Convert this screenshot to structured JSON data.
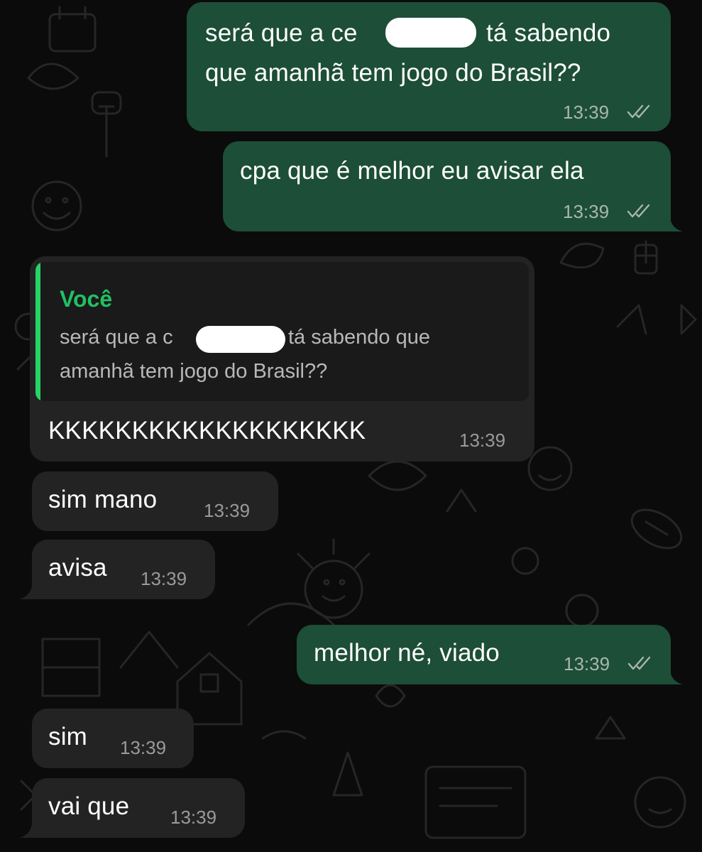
{
  "colors": {
    "outgoing_bubble": "#1d4e37",
    "incoming_bubble": "#232323",
    "quote_accent": "#21c063",
    "background": "#0b0b0b"
  },
  "messages": [
    {
      "id": "m1",
      "direction": "outgoing",
      "lines": [
        "será que a ce",
        "tá sabendo",
        "que amanhã tem jogo do Brasil??"
      ],
      "time": "13:39",
      "status": "read"
    },
    {
      "id": "m2",
      "direction": "outgoing",
      "text": "cpa que é melhor eu avisar ela",
      "time": "13:39",
      "status": "read"
    },
    {
      "id": "m3",
      "direction": "incoming",
      "reply_to": {
        "author": "Você",
        "lines": [
          "será que a c",
          "tá sabendo que",
          "amanhã tem jogo do Brasil??"
        ]
      },
      "text": "KKKKKKKKKKKKKKKKKKK",
      "time": "13:39"
    },
    {
      "id": "m4",
      "direction": "incoming",
      "text": "sim mano",
      "time": "13:39"
    },
    {
      "id": "m5",
      "direction": "incoming",
      "text": "avisa",
      "time": "13:39"
    },
    {
      "id": "m6",
      "direction": "outgoing",
      "text": "melhor né, viado",
      "time": "13:39",
      "status": "read"
    },
    {
      "id": "m7",
      "direction": "incoming",
      "text": "sim",
      "time": "13:39"
    },
    {
      "id": "m8",
      "direction": "incoming",
      "text": "vai que",
      "time": "13:39"
    }
  ],
  "icons": {
    "read_receipt": "double-check-icon"
  }
}
